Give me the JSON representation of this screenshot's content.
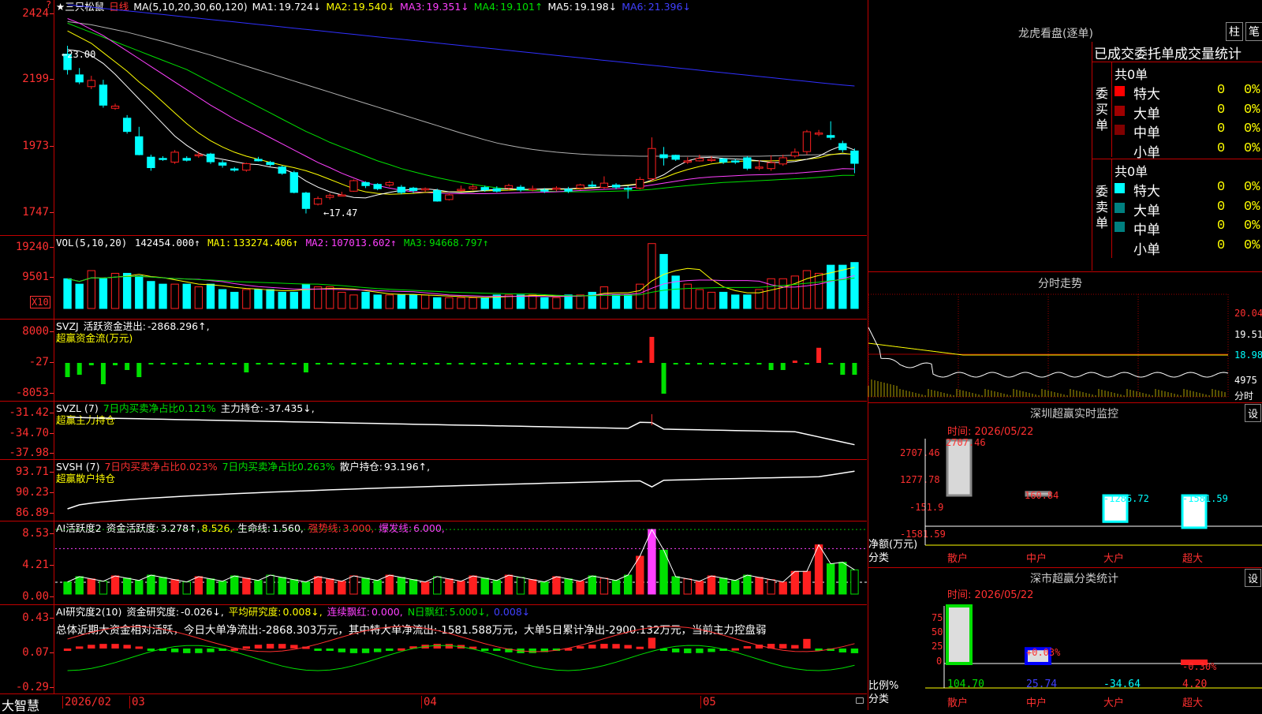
{
  "colors": {
    "up": "#ff2020",
    "down": "#00ffff",
    "ma1": "#ffffff",
    "ma2": "#ffff00",
    "ma3": "#ff40ff",
    "ma4": "#00e000",
    "ma5": "#c0c0c0",
    "ma6": "#3030ff",
    "axis": "#c00000"
  },
  "main": {
    "corner_mark": "?",
    "title": "★三只松鼠",
    "period": "日线",
    "ma_def": "MA(5,10,20,30,60,120)",
    "ma": [
      {
        "l": "MA1:",
        "v": "19.724↓"
      },
      {
        "l": "MA2:",
        "v": "19.540↓"
      },
      {
        "l": "MA3:",
        "v": "19.351↓"
      },
      {
        "l": "MA4:",
        "v": "19.101↑"
      },
      {
        "l": "MA5:",
        "v": "19.198↓"
      },
      {
        "l": "MA6:",
        "v": "21.396↓"
      }
    ],
    "yticks": [
      "2424",
      "2199",
      "1973",
      "1747"
    ],
    "high_label": "←23.00",
    "low_label": "←17.47"
  },
  "vol": {
    "def": "VOL(5,10,20)",
    "value": "142454.000↑",
    "ma": [
      {
        "l": "MA1:",
        "v": "133274.406↑"
      },
      {
        "l": "MA2:",
        "v": "107013.602↑"
      },
      {
        "l": "MA3:",
        "v": "94668.797↑"
      }
    ],
    "yticks": [
      "19240",
      "9501"
    ],
    "unit": "X10"
  },
  "svzj": {
    "name": "SVZJ",
    "l1": "活跃资金进出:",
    "v1": "-2868.296↑,",
    "sub": "超赢资金流(万元)",
    "yticks": [
      "8000",
      "-27",
      "-8053"
    ]
  },
  "svzl": {
    "name": "SVZL (7)",
    "l1": "7日内买卖净占比0.121%",
    "l2": "主力持仓:",
    "v2": "-37.435↓,",
    "sub": "超赢主力持仓",
    "yticks": [
      "-31.42",
      "-34.70",
      "-37.98"
    ]
  },
  "svsh": {
    "name": "SVSH (7)",
    "l1": "7日内买卖净占比0.023%",
    "l2": "7日内买卖净占比0.263%",
    "l3": "散户持仓:",
    "v3": "93.196↑,",
    "sub": "超赢散户持仓",
    "yticks": [
      "93.71",
      "90.23",
      "86.89"
    ]
  },
  "ai1": {
    "name": "AI活跃度2",
    "l1": "资金活跃度:",
    "v1": "3.278↑,",
    "v2": "8.526,",
    "l3": "生命线:",
    "v3": "1.560,",
    "l4": "强势线:",
    "v4": "3.000,",
    "l5": "爆发线:",
    "v5": "6.000,",
    "yticks": [
      "8.53",
      "4.21",
      "0.00"
    ]
  },
  "ai2": {
    "name": "AI研究度2(10)",
    "l1": "资金研究度:",
    "v1": "-0.026↓,",
    "l2": "平均研究度:",
    "v2": "0.008↓,",
    "l3": "连续飘红:",
    "v3": "0.000,",
    "l4": "N日飘红:",
    "v4": "5.000↓,",
    "v5": "0.008↓",
    "summary": "总体近期大资金相对活跃，今日大单净流出:-2868.303万元，其中特大单净流出:-1581.588万元，大单5日累计净出-2900.132万元，当前主力控盘弱",
    "yticks": [
      "0.43",
      "0.07",
      "-0.29"
    ]
  },
  "xaxis": {
    "brand": "大智慧",
    "labels": [
      "2026/02",
      "03",
      "04",
      "05"
    ]
  },
  "dragon": {
    "title": "龙虎看盘(逐单)",
    "btn1": "柱",
    "btn2": "笔",
    "header": "已成交委托单成交量统计",
    "buy": {
      "side": "委买单",
      "total": "共0单",
      "rows": [
        {
          "name": "特大",
          "n": "0",
          "p": "0%",
          "c": "#ff0000"
        },
        {
          "name": "大单",
          "n": "0",
          "p": "0%",
          "c": "#a00000"
        },
        {
          "name": "中单",
          "n": "0",
          "p": "0%",
          "c": "#800000"
        },
        {
          "name": "小单",
          "n": "0",
          "p": "0%",
          "c": "#000000"
        }
      ]
    },
    "sell": {
      "side": "委卖单",
      "total": "共0单",
      "rows": [
        {
          "name": "特大",
          "n": "0",
          "p": "0%",
          "c": "#00ffff"
        },
        {
          "name": "大单",
          "n": "0",
          "p": "0%",
          "c": "#008080"
        },
        {
          "name": "中单",
          "n": "0",
          "p": "0%",
          "c": "#008080"
        },
        {
          "name": "小单",
          "n": "0",
          "p": "0%",
          "c": "#000000"
        }
      ]
    }
  },
  "intraday": {
    "title": "分时走势",
    "yticks": [
      "20.04",
      "19.51",
      "18.98"
    ],
    "vol_label": "4975",
    "foot": "分时"
  },
  "monitor": {
    "title": "深圳超赢实时监控",
    "btn": "设",
    "time": "时间: 2026/05/22",
    "yticks": [
      "2707.46",
      "1277.78",
      "-151.9",
      "-1581.59"
    ],
    "ylabel": "净额(万元)",
    "xlabel": "分类",
    "bars": [
      {
        "cat": "散户",
        "v": "2707.46"
      },
      {
        "cat": "中户",
        "v": "160.84"
      },
      {
        "cat": "大户",
        "v": "-1286.72"
      },
      {
        "cat": "超大",
        "v": "-1581.59"
      }
    ]
  },
  "stats": {
    "title": "深市超赢分类统计",
    "btn": "设",
    "time": "时间: 2026/05/22",
    "yticks": [
      "75",
      "50",
      "25",
      "0"
    ],
    "ylabel": "比例%",
    "xlabel": "分类",
    "bars": [
      {
        "cat": "散户",
        "v": "104.70",
        "d": ""
      },
      {
        "cat": "中户",
        "v": "25.74",
        "d": "+0.03%"
      },
      {
        "cat": "大户",
        "v": "-34.64",
        "d": ""
      },
      {
        "cat": "超大",
        "v": "4.20",
        "d": "-0.30%"
      }
    ]
  },
  "chart_data": {
    "type": "candlestick",
    "candles": [
      [
        2285,
        2235,
        2312,
        2219
      ],
      [
        2218,
        2195,
        2240,
        2188
      ],
      [
        2180,
        2200,
        2215,
        2172
      ],
      [
        2185,
        2120,
        2202,
        2112
      ],
      [
        2110,
        2117,
        2125,
        2105
      ],
      [
        2078,
        2035,
        2088,
        2028
      ],
      [
        2018,
        1960,
        2050,
        1958
      ],
      [
        1952,
        1918,
        1960,
        1908
      ],
      [
        1948,
        1946,
        1955,
        1940
      ],
      [
        1936,
        1968,
        1975,
        1930
      ],
      [
        1948,
        1942,
        1955,
        1938
      ],
      [
        1958,
        1960,
        1970,
        1950
      ],
      [
        1962,
        1937,
        1966,
        1930
      ],
      [
        1934,
        1926,
        1942,
        1918
      ],
      [
        1914,
        1910,
        1920,
        1905
      ],
      [
        1910,
        1931,
        1934,
        1905
      ],
      [
        1945,
        1940,
        1953,
        1938
      ],
      [
        1935,
        1928,
        1940,
        1922
      ],
      [
        1920,
        1900,
        1925,
        1895
      ],
      [
        1902,
        1838,
        1908,
        1835
      ],
      [
        1836,
        1786,
        1840,
        1770
      ],
      [
        1800,
        1818,
        1825,
        1796
      ],
      [
        1822,
        1828,
        1835,
        1815
      ],
      [
        1830,
        1830,
        1840,
        1825
      ],
      [
        1842,
        1876,
        1880,
        1840
      ],
      [
        1870,
        1860,
        1874,
        1852
      ],
      [
        1864,
        1850,
        1868,
        1845
      ],
      [
        1862,
        1870,
        1875,
        1856
      ],
      [
        1855,
        1838,
        1862,
        1832
      ],
      [
        1852,
        1844,
        1856,
        1836
      ],
      [
        1846,
        1850,
        1854,
        1840
      ],
      [
        1844,
        1810,
        1850,
        1808
      ],
      [
        1815,
        1830,
        1836,
        1812
      ],
      [
        1848,
        1848,
        1860,
        1842
      ],
      [
        1850,
        1856,
        1864,
        1846
      ],
      [
        1854,
        1846,
        1860,
        1840
      ],
      [
        1850,
        1842,
        1858,
        1838
      ],
      [
        1852,
        1860,
        1866,
        1844
      ],
      [
        1855,
        1846,
        1862,
        1840
      ],
      [
        1850,
        1850,
        1860,
        1842
      ],
      [
        1846,
        1843,
        1852,
        1836
      ],
      [
        1848,
        1852,
        1858,
        1842
      ],
      [
        1848,
        1842,
        1856,
        1836
      ],
      [
        1852,
        1862,
        1866,
        1846
      ],
      [
        1862,
        1860,
        1875,
        1855
      ],
      [
        1854,
        1868,
        1890,
        1850
      ],
      [
        1862,
        1855,
        1868,
        1848
      ],
      [
        1852,
        1848,
        1858,
        1818
      ],
      [
        1852,
        1880,
        1888,
        1848
      ],
      [
        1882,
        1980,
        2016,
        1875
      ],
      [
        1960,
        1950,
        1985,
        1925
      ],
      [
        1958,
        1945,
        1960,
        1940
      ],
      [
        1940,
        1940,
        1952,
        1930
      ],
      [
        1940,
        1948,
        1960,
        1938
      ],
      [
        1942,
        1945,
        1955,
        1936
      ],
      [
        1946,
        1936,
        1950,
        1930
      ],
      [
        1940,
        1936,
        1946,
        1930
      ],
      [
        1950,
        1916,
        1955,
        1910
      ],
      [
        1920,
        1920,
        1942,
        1910
      ],
      [
        1915,
        1934,
        1958,
        1908
      ],
      [
        1930,
        1950,
        1960,
        1924
      ],
      [
        1956,
        1968,
        1980,
        1950
      ],
      [
        1970,
        2034,
        2040,
        1960
      ],
      [
        2028,
        2030,
        2040,
        2020
      ],
      [
        2022,
        2016,
        2068,
        2008
      ],
      [
        1996,
        1976,
        2005,
        1968
      ],
      [
        1972,
        1932,
        1980,
        1900
      ]
    ],
    "ma": {
      "ma1": [
        2300,
        2295,
        2280,
        2255,
        2220,
        2180,
        2140,
        2100,
        2060,
        2020,
        1990,
        1965,
        1952,
        1945,
        1938,
        1930,
        1928,
        1920,
        1915,
        1900,
        1875,
        1855,
        1840,
        1830,
        1822,
        1820,
        1830,
        1838,
        1845,
        1848,
        1850,
        1846,
        1840,
        1838,
        1840,
        1845,
        1848,
        1850,
        1848,
        1848,
        1850,
        1850,
        1850,
        1852,
        1854,
        1856,
        1858,
        1860,
        1865,
        1878,
        1895,
        1920,
        1940,
        1950,
        1952,
        1948,
        1946,
        1944,
        1940,
        1935,
        1935,
        1938,
        1945,
        1955,
        1975,
        1990,
        1975
      ],
      "ma2": [
        2360,
        2340,
        2320,
        2290,
        2260,
        2230,
        2195,
        2165,
        2130,
        2095,
        2060,
        2030,
        2005,
        1985,
        1968,
        1955,
        1945,
        1935,
        1926,
        1918,
        1908,
        1895,
        1880,
        1865,
        1850,
        1840,
        1835,
        1832,
        1833,
        1835,
        1838,
        1840,
        1840,
        1840,
        1842,
        1843,
        1844,
        1845,
        1847,
        1848,
        1848,
        1848,
        1849,
        1850,
        1852,
        1855,
        1858,
        1862,
        1866,
        1874,
        1885,
        1900,
        1912,
        1922,
        1930,
        1935,
        1938,
        1940,
        1940,
        1940,
        1941,
        1942,
        1945,
        1950,
        1960,
        1965,
        1960
      ],
      "ma3": [
        2400,
        2385,
        2365,
        2345,
        2320,
        2295,
        2270,
        2245,
        2220,
        2195,
        2170,
        2145,
        2120,
        2098,
        2075,
        2055,
        2035,
        2015,
        1995,
        1975,
        1955,
        1935,
        1918,
        1900,
        1885,
        1870,
        1860,
        1852,
        1845,
        1840,
        1838,
        1836,
        1835,
        1834,
        1834,
        1834,
        1835,
        1836,
        1837,
        1838,
        1839,
        1840,
        1842,
        1844,
        1846,
        1848,
        1850,
        1852,
        1856,
        1862,
        1868,
        1874,
        1880,
        1885,
        1888,
        1890,
        1892,
        1894,
        1895,
        1896,
        1898,
        1900,
        1903,
        1906,
        1910,
        1915,
        1914
      ],
      "ma4": [
        2385,
        2370,
        2355,
        2340,
        2325,
        2310,
        2295,
        2280,
        2265,
        2250,
        2235,
        2215,
        2195,
        2175,
        2155,
        2135,
        2115,
        2095,
        2075,
        2055,
        2035,
        2018,
        2000,
        1985,
        1970,
        1955,
        1940,
        1928,
        1915,
        1905,
        1895,
        1886,
        1878,
        1870,
        1864,
        1858,
        1853,
        1849,
        1846,
        1844,
        1842,
        1841,
        1840,
        1840,
        1840,
        1841,
        1842,
        1843,
        1845,
        1848,
        1852,
        1856,
        1860,
        1864,
        1867,
        1870,
        1872,
        1874,
        1876,
        1878,
        1880,
        1882,
        1884,
        1887,
        1890,
        1893,
        1893
      ],
      "ma5": [
        2390,
        2385,
        2380,
        2372,
        2364,
        2356,
        2346,
        2336,
        2326,
        2315,
        2304,
        2293,
        2282,
        2270,
        2258,
        2246,
        2234,
        2222,
        2210,
        2198,
        2186,
        2174,
        2162,
        2150,
        2138,
        2126,
        2114,
        2102,
        2090,
        2078,
        2066,
        2054,
        2042,
        2030,
        2019,
        2008,
        1998,
        1990,
        1983,
        1977,
        1972,
        1968,
        1965,
        1962,
        1960,
        1958,
        1957,
        1956,
        1955,
        1955,
        1955,
        1955,
        1955,
        1955,
        1955,
        1955,
        1955,
        1955,
        1955,
        1956,
        1957,
        1958,
        1959,
        1960,
        1961,
        1962,
        1962
      ],
      "ma6": [
        2445,
        2441,
        2437,
        2433,
        2429,
        2425,
        2421,
        2417,
        2413,
        2409,
        2405,
        2401,
        2397,
        2393,
        2389,
        2385,
        2381,
        2377,
        2373,
        2369,
        2365,
        2361,
        2357,
        2353,
        2349,
        2345,
        2341,
        2337,
        2333,
        2329,
        2325,
        2321,
        2317,
        2313,
        2309,
        2305,
        2301,
        2297,
        2293,
        2289,
        2285,
        2281,
        2277,
        2273,
        2269,
        2265,
        2261,
        2257,
        2253,
        2249,
        2245,
        2241,
        2237,
        2233,
        2229,
        2225,
        2221,
        2217,
        2213,
        2209,
        2205,
        2201,
        2197,
        2193,
        2189,
        2185,
        2182
      ]
    },
    "volume": [
      11,
      9,
      14,
      11,
      13,
      13,
      12,
      10,
      9,
      9,
      9,
      8,
      9,
      7,
      6,
      7,
      7,
      7,
      6,
      6,
      9,
      8,
      8,
      6,
      5,
      6,
      5,
      5,
      5,
      5,
      5,
      4,
      4,
      4,
      4,
      4,
      5,
      5,
      5,
      5,
      4,
      4,
      5,
      5,
      6,
      8,
      5,
      5,
      9,
      24,
      20,
      12,
      9,
      7,
      6,
      6,
      5,
      5,
      7,
      11,
      11,
      12,
      14,
      13,
      16,
      16,
      17
    ],
    "svzj": [
      -30,
      -25,
      -5,
      -45,
      -5,
      -15,
      -30,
      -3,
      -3,
      -3,
      -3,
      -3,
      -3,
      -3,
      -3,
      -20,
      -3,
      -3,
      -3,
      -3,
      -20,
      -3,
      -3,
      -3,
      -3,
      -3,
      -3,
      -3,
      -3,
      -3,
      -3,
      -3,
      -3,
      -3,
      -3,
      -3,
      -3,
      -3,
      -3,
      -3,
      -3,
      -3,
      -3,
      -3,
      -3,
      -3,
      -3,
      -3,
      5,
      55,
      -65,
      -3,
      -3,
      -3,
      -3,
      -3,
      -3,
      -3,
      -3,
      -15,
      -15,
      5,
      -3,
      32,
      -3,
      -25,
      -25
    ]
  }
}
